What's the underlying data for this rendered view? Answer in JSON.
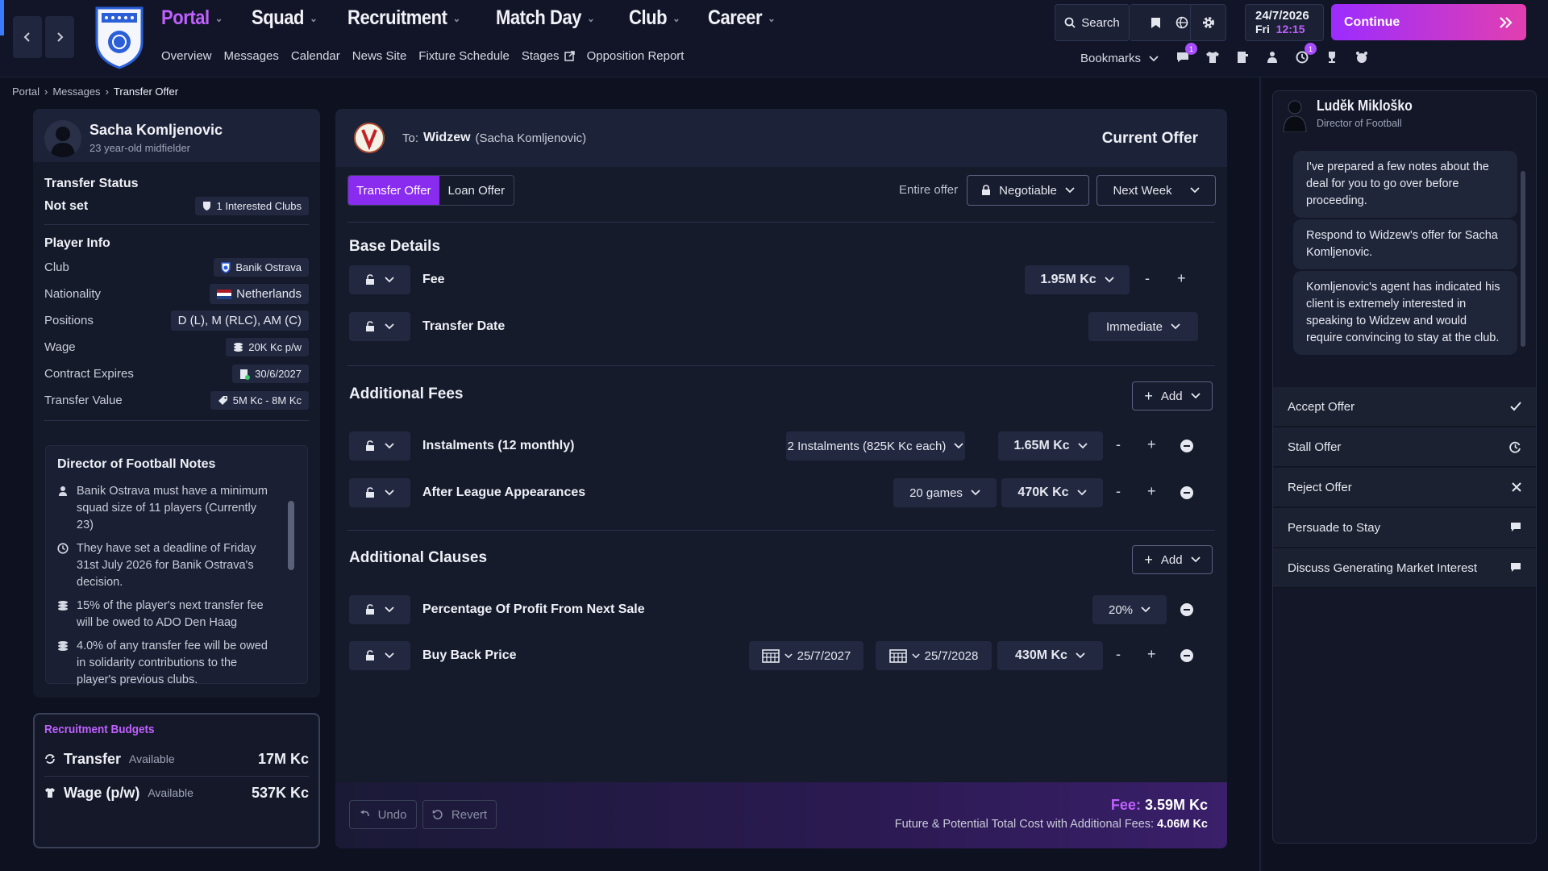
{
  "topbar": {
    "nav": [
      {
        "label": "Portal",
        "active": true
      },
      {
        "label": "Squad"
      },
      {
        "label": "Recruitment"
      },
      {
        "label": "Match Day"
      },
      {
        "label": "Club"
      },
      {
        "label": "Career"
      }
    ],
    "subnav": [
      "Overview",
      "Messages",
      "Calendar",
      "News Site",
      "Fixture Schedule",
      "Stages",
      "Opposition Report"
    ],
    "search_label": "Search",
    "date": "24/7/2026",
    "day": "Fri",
    "time": "12:15",
    "continue_label": "Continue",
    "bookmarks_label": "Bookmarks",
    "badges": {
      "messages": "1",
      "notifications": "1"
    }
  },
  "breadcrumb": [
    "Portal",
    "Messages",
    "Transfer Offer"
  ],
  "player": {
    "name": "Sacha Komljenovic",
    "subtitle": "23 year-old midfielder",
    "transfer_status_title": "Transfer Status",
    "transfer_status": "Not set",
    "interested": "1 Interested Clubs",
    "info_title": "Player Info",
    "info": [
      {
        "label": "Club",
        "value": "Banik Ostrava",
        "icon": "club-crest-icon"
      },
      {
        "label": "Nationality",
        "value": "Netherlands",
        "icon": "netherlands-flag-icon"
      },
      {
        "label": "Positions",
        "value": "D (L), M (RLC), AM (C)",
        "icon": ""
      },
      {
        "label": "Wage",
        "value": "20K Kc p/w",
        "icon": "coins-icon"
      },
      {
        "label": "Contract Expires",
        "value": "30/6/2027",
        "icon": "contract-icon"
      },
      {
        "label": "Transfer Value",
        "value": "5M Kc - 8M Kc",
        "icon": "tag-icon"
      }
    ]
  },
  "dof_notes": {
    "title": "Director of Football Notes",
    "items": [
      {
        "icon": "person-icon",
        "text": "Banik Ostrava must have a minimum squad size of 11 players (Currently 23)"
      },
      {
        "icon": "clock-icon",
        "text": "They have set a deadline of Friday 31st July 2026 for Banik Ostrava's decision."
      },
      {
        "icon": "coins-icon",
        "text": "15% of the player's next transfer fee will be owed to ADO Den Haag"
      },
      {
        "icon": "coins-icon",
        "text": "4.0% of any transfer fee will be owed in solidarity contributions to the player's previous clubs."
      }
    ]
  },
  "budgets": {
    "title": "Recruitment Budgets",
    "transfer_label": "Transfer",
    "transfer_avail": "Available",
    "transfer_value": "17M Kc",
    "wage_label": "Wage (p/w)",
    "wage_avail": "Available",
    "wage_value": "537K Kc"
  },
  "offer": {
    "to_prefix": "To:",
    "to_club": "Widzew",
    "to_player": "(Sacha Komljenovic)",
    "current_offer": "Current Offer",
    "tabs": [
      "Transfer Offer",
      "Loan Offer"
    ],
    "entire_offer_label": "Entire offer",
    "negotiable": "Negotiable",
    "next_week": "Next Week",
    "base_title": "Base Details",
    "fee_label": "Fee",
    "fee_value": "1.95M Kc",
    "date_label": "Transfer Date",
    "date_value": "Immediate",
    "add_fees_title": "Additional Fees",
    "add_label": "Add",
    "instalments_label": "Instalments (12 monthly)",
    "instalments_option": "2 Instalments (825K Kc each)",
    "instalments_value": "1.65M Kc",
    "appearances_label": "After League Appearances",
    "appearances_option": "20 games",
    "appearances_value": "470K Kc",
    "clauses_title": "Additional Clauses",
    "profit_label": "Percentage Of Profit From Next Sale",
    "profit_value": "20%",
    "buyback_label": "Buy Back Price",
    "buyback_date1": "25/7/2027",
    "buyback_date2": "25/7/2028",
    "buyback_value": "430M Kc",
    "minus": "-",
    "plus": "+",
    "undo": "Undo",
    "revert": "Revert",
    "total_fee_label": "Fee:",
    "total_fee_value": "3.59M Kc",
    "total_cost_label": "Future & Potential Total Cost with Additional Fees:",
    "total_cost_value": "4.06M Kc"
  },
  "director": {
    "name": "Luděk Mikloško",
    "role": "Director of Football",
    "messages": [
      "I've prepared a few notes about the deal for you to go over before proceeding.",
      "Respond to Widzew's offer for Sacha Komljenovic.",
      "Komljenovic's agent has indicated his client is extremely interested in speaking to Widzew and would require convincing to stay at the club."
    ],
    "actions": [
      {
        "label": "Accept Offer",
        "icon": "check-icon"
      },
      {
        "label": "Stall Offer",
        "icon": "stall-icon"
      },
      {
        "label": "Reject Offer",
        "icon": "close-icon"
      },
      {
        "label": "Persuade to Stay",
        "icon": "chat-icon"
      },
      {
        "label": "Discuss Generating Market Interest",
        "icon": "chat-icon"
      }
    ]
  },
  "colors": {
    "accent": "#a23cff",
    "pink": "#e23fb0",
    "bg": "#0d1120"
  }
}
